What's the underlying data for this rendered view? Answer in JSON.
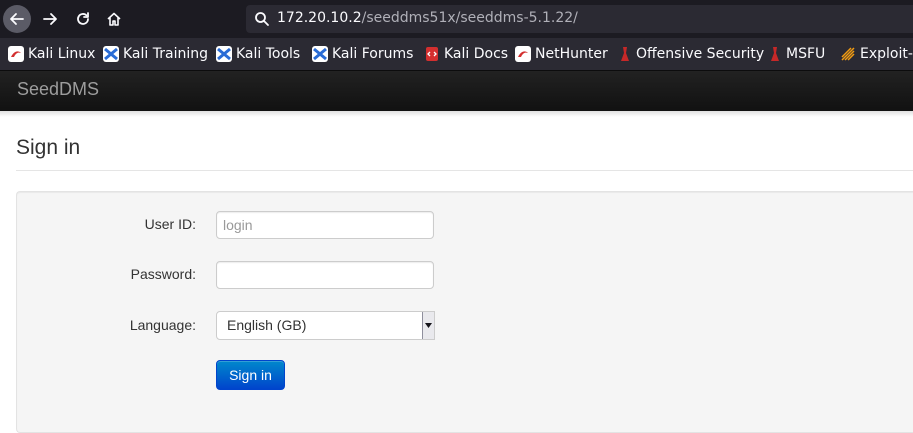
{
  "browser": {
    "url_host": "172.20.10.2",
    "url_path": "/seeddms51x/seeddms-5.1.22/"
  },
  "bookmarks": [
    {
      "label": "Kali Linux",
      "icon": "kali-dragon-icon"
    },
    {
      "label": "Kali Training",
      "icon": "kali-blue-icon"
    },
    {
      "label": "Kali Tools",
      "icon": "kali-blue-icon"
    },
    {
      "label": "Kali Forums",
      "icon": "kali-blue-icon"
    },
    {
      "label": "Kali Docs",
      "icon": "kali-docs-icon"
    },
    {
      "label": "NetHunter",
      "icon": "kali-dragon-icon"
    },
    {
      "label": "Offensive Security",
      "icon": "offsec-icon"
    },
    {
      "label": "MSFU",
      "icon": "offsec-icon"
    },
    {
      "label": "Exploit-",
      "icon": "exploit-db-icon"
    }
  ],
  "app": {
    "brand": "SeedDMS"
  },
  "signin": {
    "title": "Sign in",
    "userid_label": "User ID:",
    "userid_placeholder": "login",
    "userid_value": "",
    "password_label": "Password:",
    "password_value": "",
    "language_label": "Language:",
    "language_value": "English (GB)",
    "submit_label": "Sign in"
  },
  "colors": {
    "navbar": "#1b1b1b",
    "button": "#0064cd",
    "browser_chrome": "#2b2a33"
  }
}
